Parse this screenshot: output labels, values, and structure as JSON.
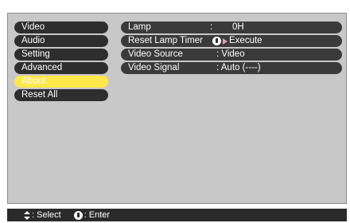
{
  "main_menu": {
    "items": [
      {
        "label": "Video"
      },
      {
        "label": "Audio"
      },
      {
        "label": "Setting"
      },
      {
        "label": "Advanced"
      },
      {
        "label": "About",
        "selected": true
      },
      {
        "label": "Reset All"
      }
    ]
  },
  "sub_menu": {
    "lamp": {
      "label": "Lamp",
      "colon": ":",
      "value": "0H"
    },
    "reset_lamp_timer": {
      "label": "Reset Lamp Timer",
      "action": "Execute",
      "icons": [
        "enter-button-icon",
        "arrow-right-icon"
      ]
    },
    "video_source": {
      "label": "Video Source",
      "value": ": Video"
    },
    "video_signal": {
      "label": "Video Signal",
      "value": ": Auto (----)"
    }
  },
  "footer": {
    "select_label": ": Select",
    "enter_label": ": Enter",
    "icons": [
      "up-down-arrow-icon",
      "enter-button-icon"
    ]
  },
  "colors": {
    "selected_item": "#ffe84a",
    "menu_item_bg": "#2e2e2e",
    "panel_bg": "#c8c8c8",
    "footer_bg": "#2a2a2a"
  }
}
